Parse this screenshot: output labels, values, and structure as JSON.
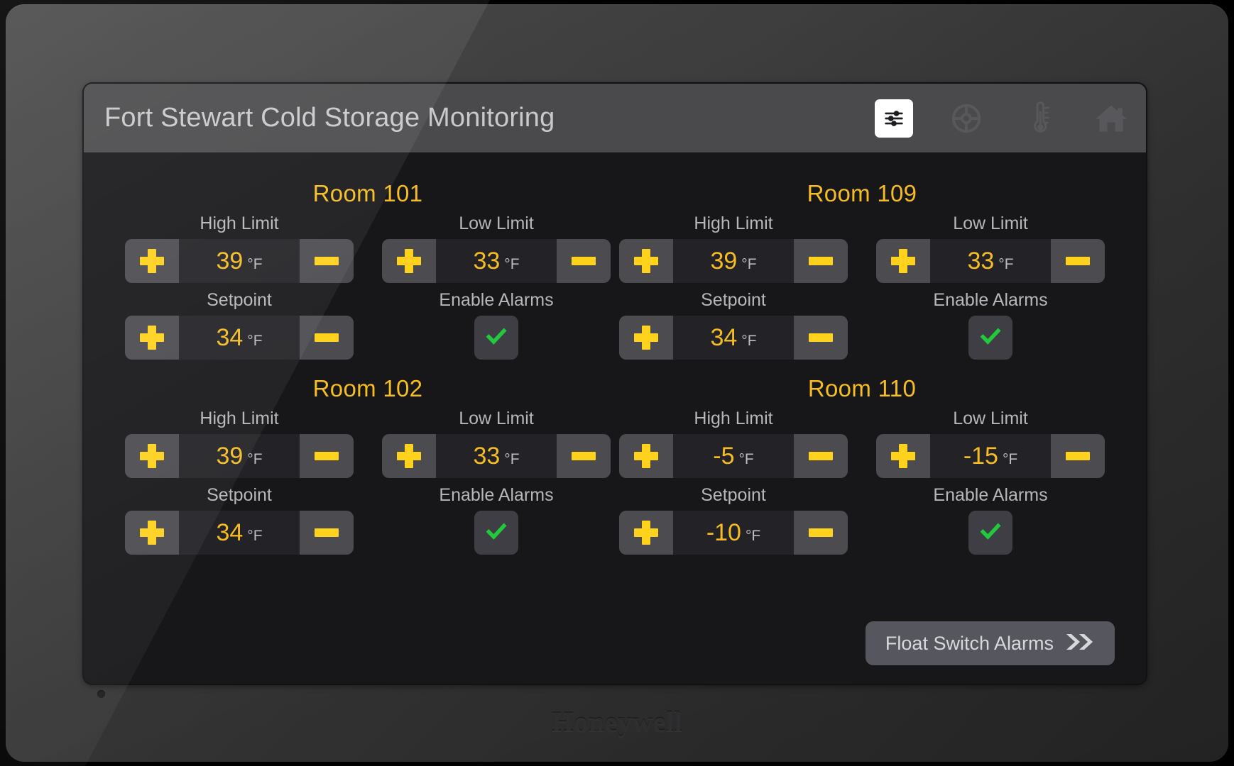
{
  "header": {
    "title": "Fort Stewart Cold Storage Monitoring",
    "icons": [
      {
        "name": "sliders-icon",
        "active": true
      },
      {
        "name": "target-icon",
        "active": false
      },
      {
        "name": "thermometer-icon",
        "active": false
      },
      {
        "name": "home-icon",
        "active": false
      }
    ]
  },
  "labels": {
    "high_limit": "High Limit",
    "low_limit": "Low Limit",
    "setpoint": "Setpoint",
    "enable_alarms": "Enable Alarms",
    "unit": "°F",
    "plus": "+",
    "minus": "−",
    "checked": "✓"
  },
  "rooms": [
    {
      "title": "Room 101",
      "high_limit": "39",
      "low_limit": "33",
      "setpoint": "34",
      "enable_alarms": true
    },
    {
      "title": "Room 109",
      "high_limit": "39",
      "low_limit": "33",
      "setpoint": "34",
      "enable_alarms": true
    },
    {
      "title": "Room 102",
      "high_limit": "39",
      "low_limit": "33",
      "setpoint": "34",
      "enable_alarms": true
    },
    {
      "title": "Room 110",
      "high_limit": "-5",
      "low_limit": "-15",
      "setpoint": "-10",
      "enable_alarms": true
    }
  ],
  "float_switch": {
    "label": "Float Switch Alarms",
    "icon": "double-chevron-right-icon"
  },
  "brand": {
    "name": "Honeywell"
  },
  "colors": {
    "accent_yellow": "#f5bc23",
    "button_yellow": "#ffd21e",
    "check_green": "#22c93c",
    "screen_bg": "#17171a",
    "header_bg": "#4a4a4c",
    "label_gray": "#b7b7bb"
  }
}
